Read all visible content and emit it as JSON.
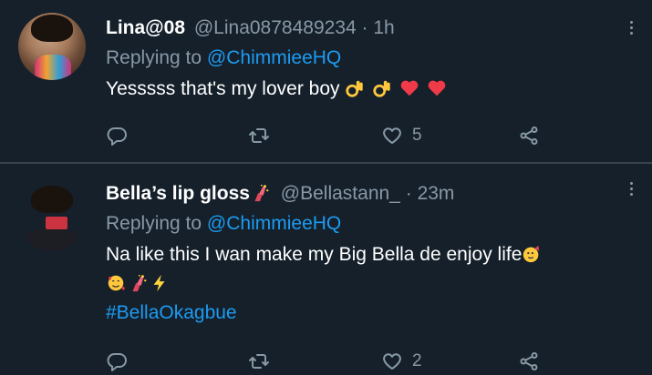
{
  "tweets": [
    {
      "name": "Lina@08",
      "handle": "@Lina0878489234",
      "dot": "·",
      "time": "1h",
      "reply_prefix": "Replying to ",
      "reply_mention": "@ChimmieeHQ",
      "text": "Yesssss that's my lover boy",
      "text_emojis": [
        "ok-hand-emoji",
        "ok-hand-emoji",
        "red-heart-emoji",
        "red-heart-emoji"
      ],
      "like_count": "5"
    },
    {
      "name": "Bella’s lip gloss",
      "name_emoji": "sparkle-hands-emoji",
      "handle": "@Bellastann_",
      "dot": "·",
      "time": "23m",
      "reply_prefix": "Replying to ",
      "reply_mention": "@ChimmieeHQ",
      "text_line1": "Na like this I wan make my Big Bella de enjoy life",
      "line1_emoji": "partying-face-emoji",
      "line2_emojis": [
        "smiling-face-with-hearts-emoji",
        "sparkle-hands-emoji",
        "lightning-emoji"
      ],
      "hashtag": "#BellaOkagbue",
      "like_count": "2"
    }
  ],
  "colors": {
    "background": "#15202b",
    "muted": "#8899a6",
    "accent": "#1d9bf0",
    "divider": "#38444d"
  }
}
